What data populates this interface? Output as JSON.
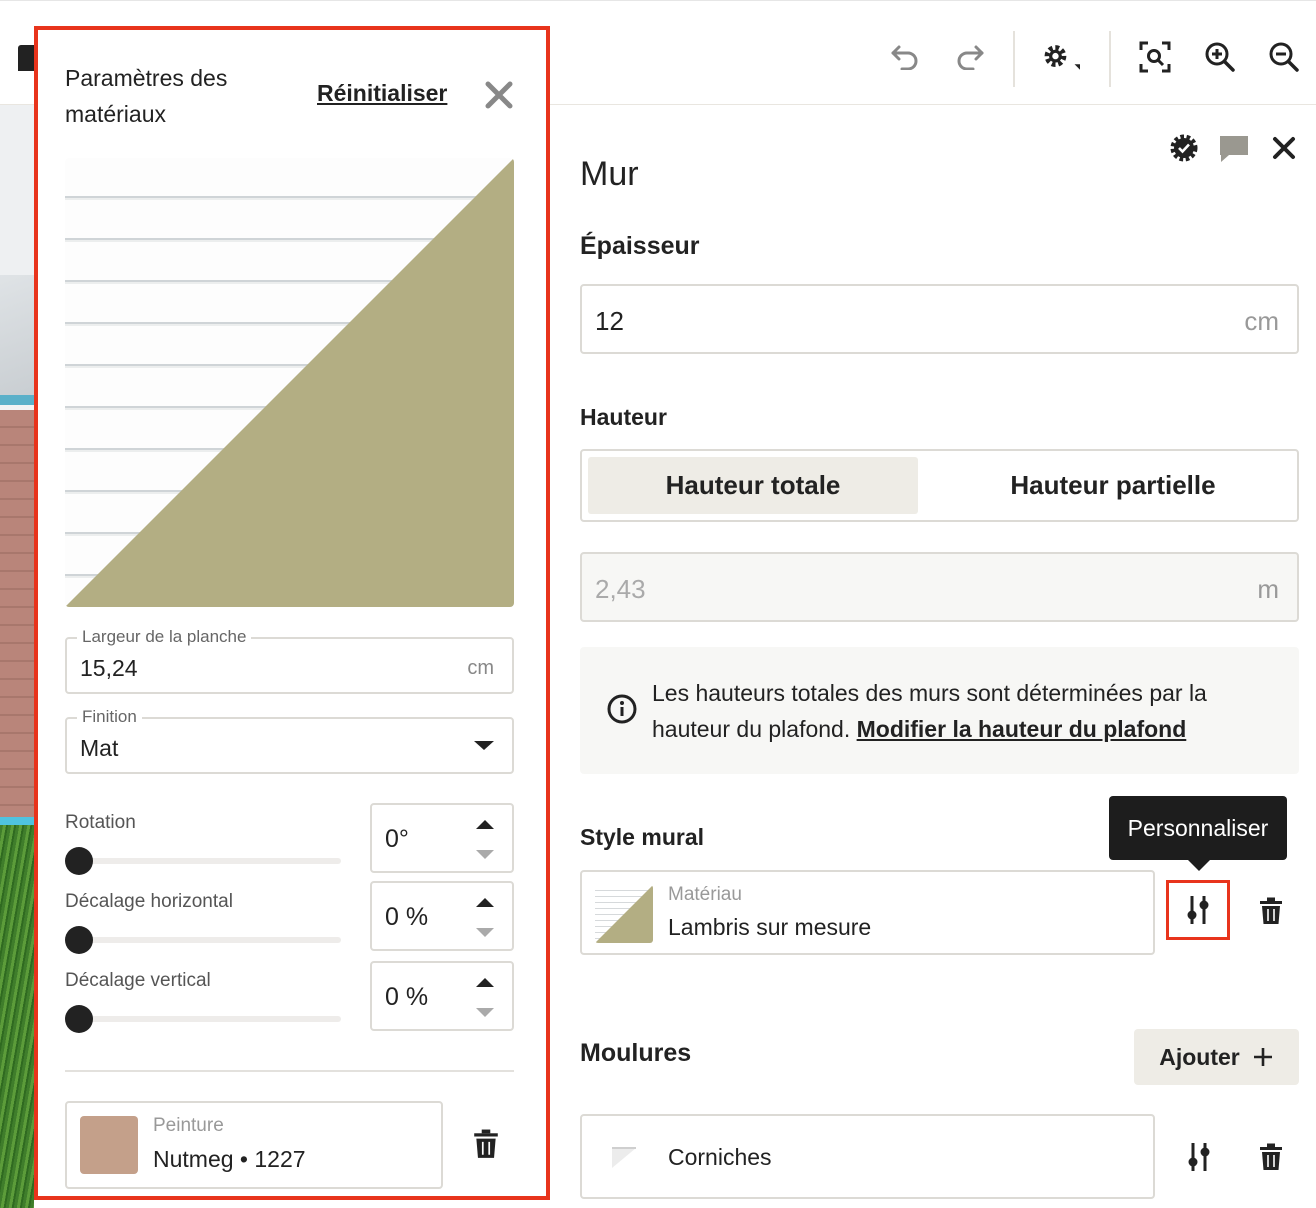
{
  "toolbar": {
    "icons": [
      "undo-icon",
      "redo-icon",
      "settings-icon",
      "focus-search-icon",
      "zoom-in-icon",
      "zoom-out-icon"
    ]
  },
  "material_panel": {
    "title": "Paramètres des matériaux",
    "reset_label": "Réinitialiser",
    "board_width": {
      "label": "Largeur de la planche",
      "value": "15,24",
      "unit": "cm"
    },
    "finish": {
      "label": "Finition",
      "value": "Mat"
    },
    "rotation": {
      "label": "Rotation",
      "value": "0°",
      "level": 0
    },
    "offset_h": {
      "label": "Décalage horizontal",
      "value": "0 %",
      "level": 0
    },
    "offset_v": {
      "label": "Décalage vertical",
      "value": "0 %",
      "level": 0
    },
    "paint": {
      "category": "Peinture",
      "name": "Nutmeg • 1227",
      "color": "#c4a08a"
    },
    "preview_color": "#b3ae83"
  },
  "props": {
    "title": "Mur",
    "thickness": {
      "label": "Épaisseur",
      "value": "12",
      "unit": "cm"
    },
    "height": {
      "label": "Hauteur",
      "options": [
        "Hauteur totale",
        "Hauteur partielle"
      ],
      "selected": "Hauteur totale",
      "value": "2,43",
      "unit": "m"
    },
    "info": {
      "text": "Les hauteurs totales des murs sont déterminées par la hauteur du plafond.",
      "link": "Modifier la hauteur du plafond"
    },
    "wall_style": {
      "label": "Style mural",
      "category": "Matériau",
      "name": "Lambris sur mesure",
      "tooltip": "Personnaliser"
    },
    "moldings": {
      "label": "Moulures",
      "add_label": "Ajouter",
      "items": [
        {
          "name": "Corniches"
        }
      ]
    }
  },
  "colors": {
    "highlight": "#e8341c",
    "accent_bg": "#eeece6"
  }
}
